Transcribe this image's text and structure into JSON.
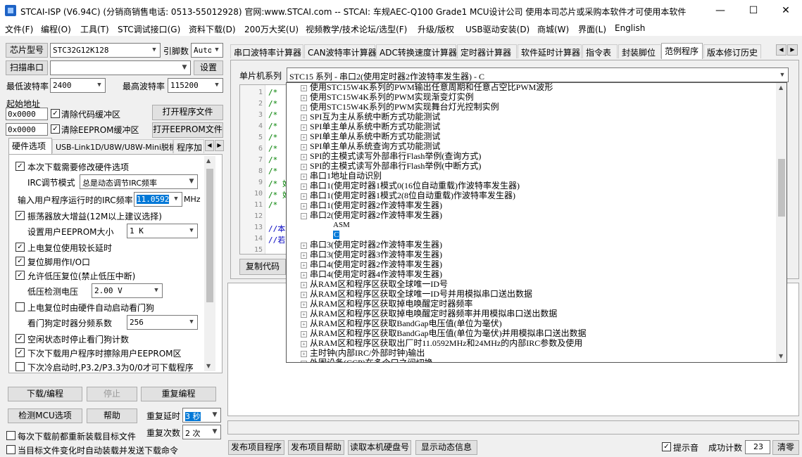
{
  "window": {
    "title": "STCAI-ISP (V6.94C) (分销商销售电话: 0513-55012928) 官网:www.STCAI.com  -- STCAI: 车规AEC-Q100 Grade1 MCU设计公司 使用本司芯片或采购本软件才可使用本软件",
    "minimize": "—",
    "maximize": "☐",
    "close": "✕"
  },
  "menu": [
    "文件(F)",
    "编程(O)",
    "工具(T)",
    "STC调试接口(G)",
    "资料下载(D)",
    "200万大奖(U)",
    "视频教学/技术论坛/选型(F)",
    "升级/版权",
    "USB驱动安装(D)",
    "商城(W)",
    "界面(L)",
    "English"
  ],
  "left": {
    "chip_label": "芯片型号",
    "chip_value": "STC32G12K128",
    "pins_label": "引脚数",
    "pins_value": "Auto",
    "scan_button": "扫描串口",
    "port_value": "",
    "settings_button": "设置",
    "min_baud_label": "最低波特率",
    "min_baud_value": "2400",
    "max_baud_label": "最高波特率",
    "max_baud_value": "115200",
    "start_addr_label": "起始地址",
    "addr1": "0x0000",
    "clear_code": "清除代码缓冲区",
    "open_file": "打开程序文件",
    "addr2": "0x0000",
    "clear_eeprom": "清除EEPROM缓冲区",
    "open_eeprom": "打开EEPROM文件",
    "tabs": [
      "硬件选项",
      "USB-Link1D/U8W/U8W-Mini脱机",
      "程序加"
    ],
    "options": {
      "opt1": "本次下载需要修改硬件选项",
      "irc_mode_label": "IRC调节模式",
      "irc_mode_value": "总是动态调节IRC频率",
      "irc_freq_label": "输入用户程序运行时的IRC频率",
      "irc_freq_value": "11.0592",
      "irc_unit": "MHz",
      "opt2": "振荡器放大增益(12M以上建议选择)",
      "eeprom_size_label": "设置用户EEPROM大小",
      "eeprom_size_value": "1    K",
      "opt3": "上电复位使用较长延时",
      "opt4": "复位脚用作I/O口",
      "opt5": "允许低压复位(禁止低压中断)",
      "lvd_label": "低压检测电压",
      "lvd_value": "2.00 V",
      "opt6": "上电复位时由硬件自动启动看门狗",
      "wdt_label": "看门狗定时器分频系数",
      "wdt_value": "256",
      "opt7": "空闲状态时停止看门狗计数",
      "opt8": "下次下载用户程序时擦除用户EEPROM区",
      "opt9": "下次冷启动时,P3.2/P3.3为0/0才可下载程序"
    },
    "download_button": "下载/编程",
    "stop_button": "停止",
    "reprogram_button": "重复编程",
    "detect_button": "检测MCU选项",
    "help_button": "帮助",
    "repeat_delay_label": "重复延时",
    "repeat_delay_value": "3 秒",
    "repeat_count_label": "重复次数",
    "repeat_count_value": "2 次",
    "reload_each": "每次下载前都重新装载目标文件",
    "auto_reload": "当目标文件变化时自动装载并发送下载命令"
  },
  "right": {
    "tabs": [
      "串口波特率计算器",
      "CAN波特率计算器",
      "ADC转换速度计算器",
      "定时器计算器",
      "软件延时计算器",
      "指令表",
      "封装脚位",
      "范例程序",
      "版本修订历史"
    ],
    "mcu_series_label": "单片机系列",
    "mcu_series_value": "STC15 系列 - 串口2(使用定时器2作波特率发生器) - C",
    "code_lines": [
      "/*",
      "/*",
      "/*",
      "/*",
      "/*",
      "/*",
      "/*",
      "/*",
      "/* 如",
      "/* 如",
      "/*",
      "",
      "//本",
      "//若",
      ""
    ],
    "copy_button": "复制代码",
    "tree": [
      "使用STC15W4K系列的PWM输出任意周期和任意占空比PWM波形",
      "使用STC15W4K系列的PWM实现渐变灯实例",
      "使用STC15W4K系列的PWM实现舞台灯光控制实例",
      "SPI互为主从系统中断方式功能测试",
      "SPI单主单从系统中断方式功能测试",
      "SPI单主单从系统中断方式功能测试",
      "SPI单主单从系统查询方式功能测试",
      "SPI的主模式读写外部串行Flash举例(查询方式)",
      "SPI的主模式读写外部串行Flash举例(中断方式)",
      "串口1地址自动识别",
      "串口1(使用定时器1模式0(16位自动重载)作波特率发生器)",
      "串口1(使用定时器1模式2(8位自动重载)作波特率发生器)",
      "串口1(使用定时器2作波特率发生器)",
      "串口2(使用定时器2作波特率发生器)",
      "ASM",
      "C",
      "串口3(使用定时器2作波特率发生器)",
      "串口3(使用定时器3作波特率发生器)",
      "串口4(使用定时器2作波特率发生器)",
      "串口4(使用定时器4作波特率发生器)",
      "从RAM区和程序区获取全球唯一ID号",
      "从RAM区和程序区获取全球唯一ID号并用模拟串口送出数据",
      "从RAM区和程序区获取掉电唤醒定时器频率",
      "从RAM区和程序区获取掉电唤醒定时器频率并用模拟串口送出数据",
      "从RAM区和程序区获取BandGap电压值(单位为毫伏)",
      "从RAM区和程序区获取BandGap电压值(单位为毫伏)并用模拟串口送出数据",
      "从RAM区和程序区获取出厂时11.0592MHz和24MHz的内部IRC参数及使用",
      "主时钟(内部IRC/外部时钟)输出",
      "外围设备(CCP)在多个口之间切换"
    ],
    "bottom_buttons": [
      "发布项目程序",
      "发布项目帮助",
      "读取本机硬盘号",
      "显示动态信息"
    ],
    "sound_label": "提示音",
    "success_label": "成功计数",
    "success_value": "23",
    "clear_button": "清零"
  }
}
